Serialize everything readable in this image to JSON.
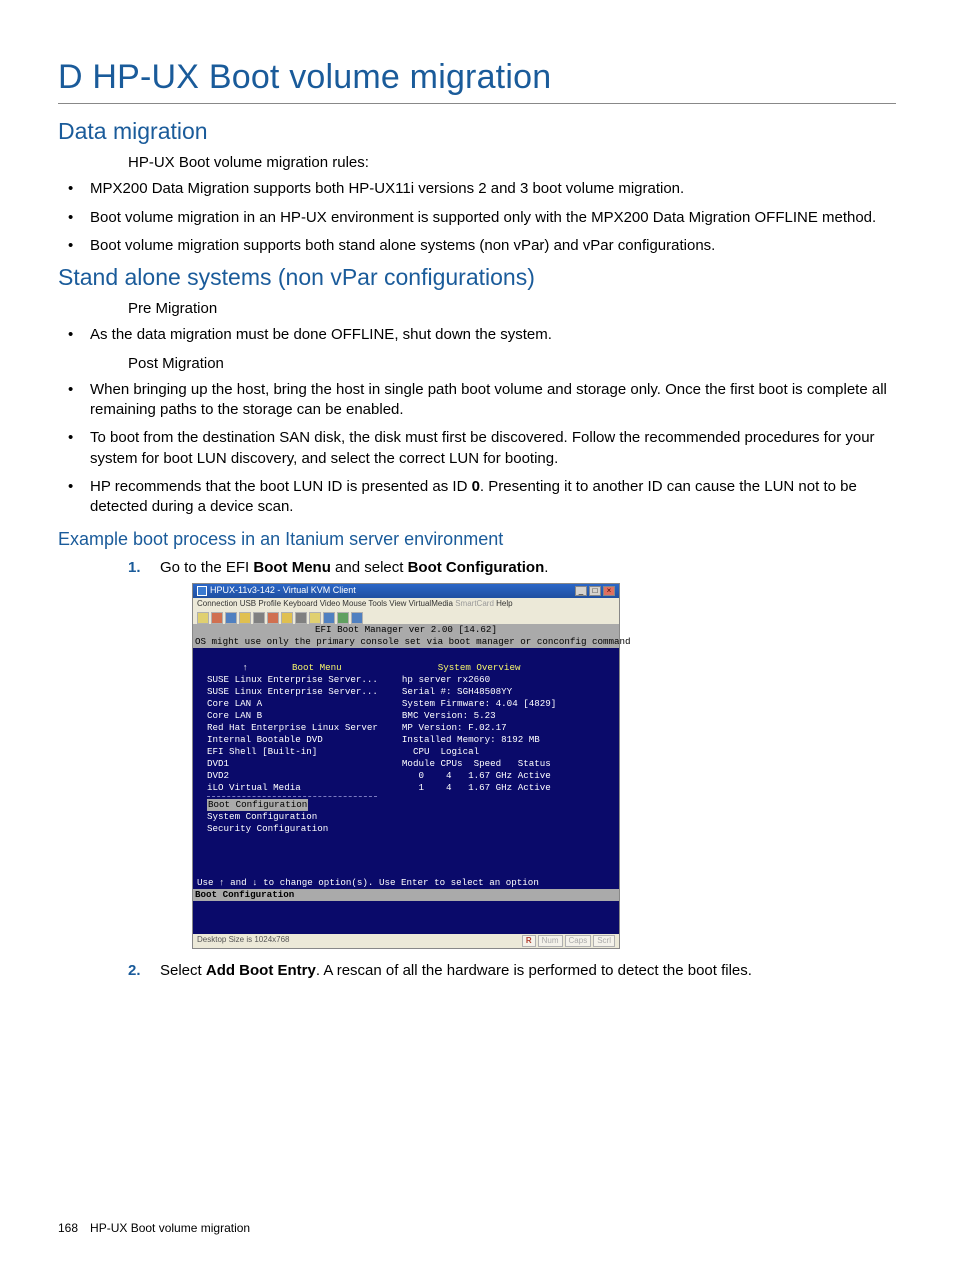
{
  "headings": {
    "h1": "D HP-UX Boot volume migration",
    "h2a": "Data migration",
    "h2b": "Stand alone systems (non vPar configurations)",
    "h3": "Example boot process in an Itanium server environment"
  },
  "intro": "HP-UX Boot volume migration rules:",
  "rules": [
    "MPX200 Data Migration supports both HP-UX11i versions 2 and 3 boot volume migration.",
    "Boot volume migration in an HP-UX environment is supported only with the MPX200 Data Migration OFFLINE method.",
    "Boot volume migration supports both stand alone systems (non vPar) and vPar configurations."
  ],
  "pre_label": "Pre Migration",
  "pre_items": [
    "As the data migration must be done OFFLINE, shut down the system."
  ],
  "post_label": "Post Migration",
  "post_items": [
    "When bringing up the host, bring the host in single path boot volume and storage only. Once the first boot is complete all remaining paths to the storage can be enabled.",
    "To boot from the destination SAN disk, the disk must first be discovered. Follow the recommended procedures for your system for boot LUN discovery, and select the correct LUN for booting."
  ],
  "post_item_3": {
    "pre": "HP recommends that the boot LUN ID is presented as ID ",
    "bold": "0",
    "post": ". Presenting it to another ID can cause the LUN not to be detected during a device scan."
  },
  "steps": {
    "s1": {
      "a": "Go to the EFI ",
      "b": "Boot Menu",
      "c": " and select ",
      "d": "Boot Configuration",
      "e": "."
    },
    "s2": {
      "a": "Select ",
      "b": "Add Boot Entry",
      "c": ". A rescan of all the hardware is performed to detect the boot files."
    }
  },
  "kvm": {
    "title": "HPUX-11v3-142 - Virtual KVM Client",
    "menu": {
      "items": "Connection  USB Profile  Keyboard  Video  Mouse  Tools  View  VirtualMedia",
      "dim": "  SmartCard",
      "last": "   Help"
    },
    "status_left": "Desktop Size is 1024x768",
    "status_r": "R"
  },
  "bios": {
    "hdr": "EFI Boot Manager ver 2.00 [14.62]",
    "warn": "OS might use only the primary console set via boot manager or conconfig command",
    "menu_title": "Boot Menu",
    "menu_items": [
      "SUSE Linux Enterprise Server...",
      "SUSE Linux Enterprise Server...",
      "Core LAN A",
      "Core LAN B",
      "Red Hat Enterprise Linux Server",
      "Internal Bootable DVD",
      "EFI Shell [Built-in]",
      "DVD1",
      "DVD2",
      "iLO Virtual Media"
    ],
    "menu_sep_items": [
      "Boot Configuration",
      "System Configuration",
      "Security Configuration"
    ],
    "overview_title": "System Overview",
    "overview": [
      "hp server rx2660",
      "Serial #:  SGH48508YY",
      "",
      "System Firmware:  4.04 [4829]",
      "BMC Version:     5.23",
      "MP Version:      F.02.17",
      "Installed Memory: 8192 MB",
      "",
      "  CPU  Logical",
      "Module CPUs  Speed   Status",
      "   0    4   1.67 GHz Active",
      "   1    4   1.67 GHz Active"
    ],
    "foot1": "Use ↑ and ↓ to change option(s). Use Enter to select an option",
    "foot2": "Boot Configuration"
  },
  "footer": {
    "page": "168",
    "title": "HP-UX Boot volume migration"
  }
}
